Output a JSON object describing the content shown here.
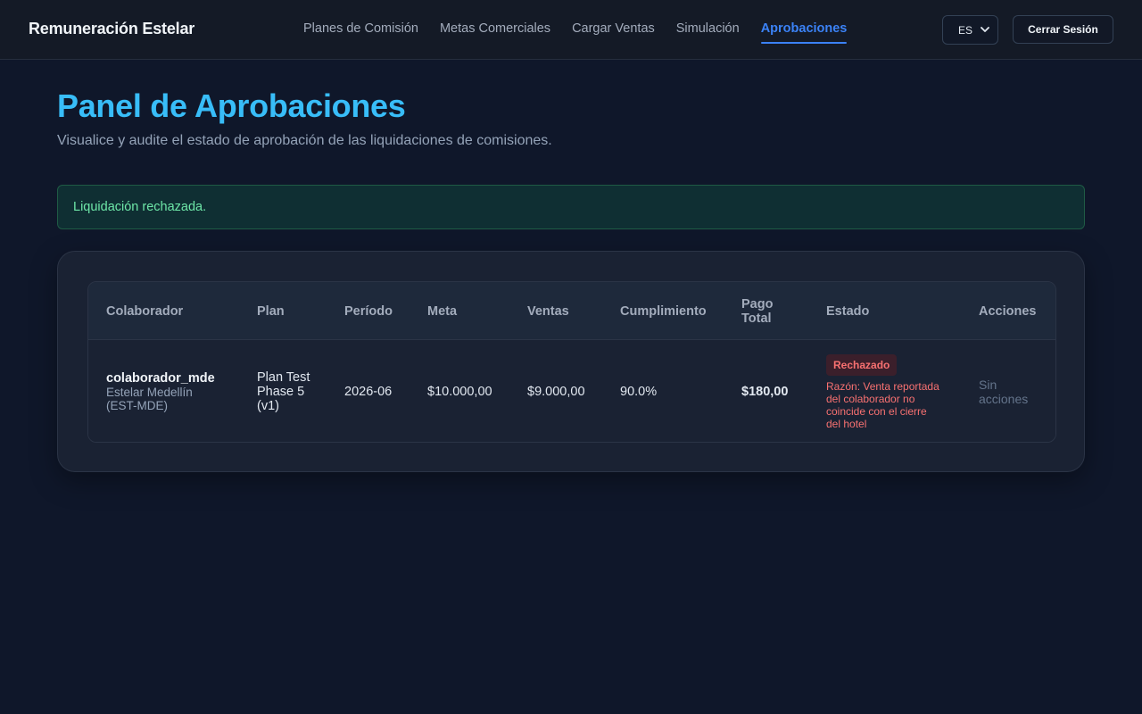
{
  "header": {
    "brand": "Remuneración Estelar",
    "nav": [
      {
        "label": "Planes de Comisión",
        "active": false
      },
      {
        "label": "Metas Comerciales",
        "active": false
      },
      {
        "label": "Cargar Ventas",
        "active": false
      },
      {
        "label": "Simulación",
        "active": false
      },
      {
        "label": "Aprobaciones",
        "active": true
      }
    ],
    "language": "ES",
    "logout_label": "Cerrar Sesión"
  },
  "page": {
    "title": "Panel de Aprobaciones",
    "subtitle": "Visualice y audite el estado de aprobación de las liquidaciones de comisiones."
  },
  "alert": {
    "message": "Liquidación rechazada.",
    "color": "#6ee7a8"
  },
  "table": {
    "headers": {
      "colaborador": "Colaborador",
      "plan": "Plan",
      "periodo": "Período",
      "meta": "Meta",
      "ventas": "Ventas",
      "cumplimiento": "Cumplimiento",
      "pago_total": "Pago Total",
      "estado": "Estado",
      "acciones": "Acciones"
    },
    "rows": [
      {
        "colaborador_user": "colaborador_mde",
        "colaborador_hotel": "Estelar Medellín (EST-MDE)",
        "plan": "Plan Test Phase 5 (v1)",
        "periodo": "2026-06",
        "meta": "$10.000,00",
        "ventas": "$9.000,00",
        "cumplimiento": "90.0%",
        "pago_total": "$180,00",
        "estado": "Rechazado",
        "razon": "Razón: Venta reportada del colaborador no coincide con el cierre del hotel",
        "acciones": "Sin acciones"
      }
    ]
  },
  "colors": {
    "accent": "#3b82f6",
    "title": "#38bdf8",
    "rejected": "#f87171"
  }
}
